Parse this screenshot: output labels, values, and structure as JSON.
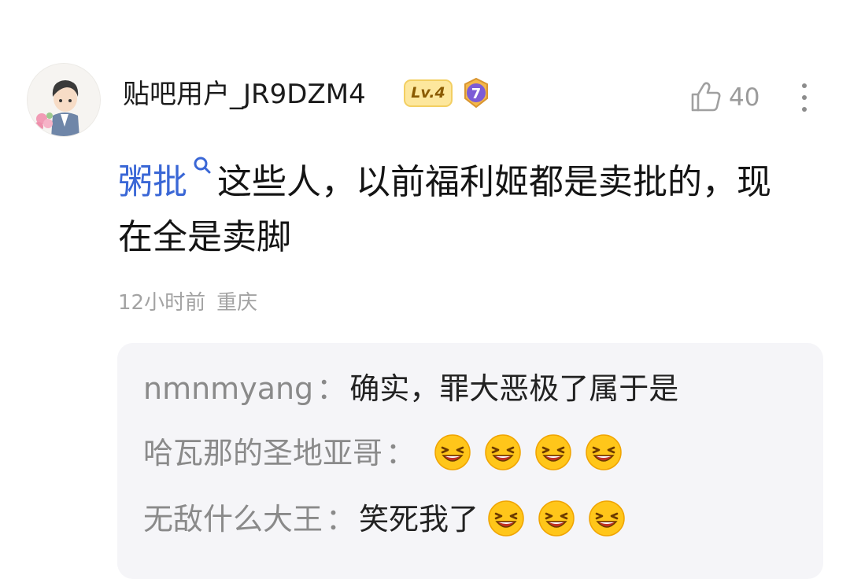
{
  "comment": {
    "username": "贴吧用户_JR9DZM4",
    "level_badge": "Lv.4",
    "rank_badge": "7",
    "like_count": "40",
    "topic_link": "粥批",
    "text": "这些人，以前福利姬都是卖批的，现在全是卖脚",
    "time": "12小时前",
    "location": "重庆"
  },
  "replies": [
    {
      "author": "nmnmyang",
      "colon": "：",
      "text": "确实，罪大恶极了属于是",
      "emoji_count": 0
    },
    {
      "author": "哈瓦那的圣地亚哥",
      "colon": "：",
      "text": "",
      "emoji_count": 4,
      "emoji": "grinning-squint-face"
    },
    {
      "author": "无敌什么大王",
      "colon": "：",
      "text": "笑死我了",
      "emoji_count": 3,
      "emoji": "grinning-squint-face"
    }
  ],
  "colors": {
    "link": "#3a67d6",
    "reply_bg": "#f5f5f8",
    "badge_bg": "#fde79d",
    "rank_badge": "#7c5cd6"
  },
  "icons": [
    "like-icon",
    "more-icon",
    "search-icon",
    "grinning-squint-face-emoji"
  ]
}
